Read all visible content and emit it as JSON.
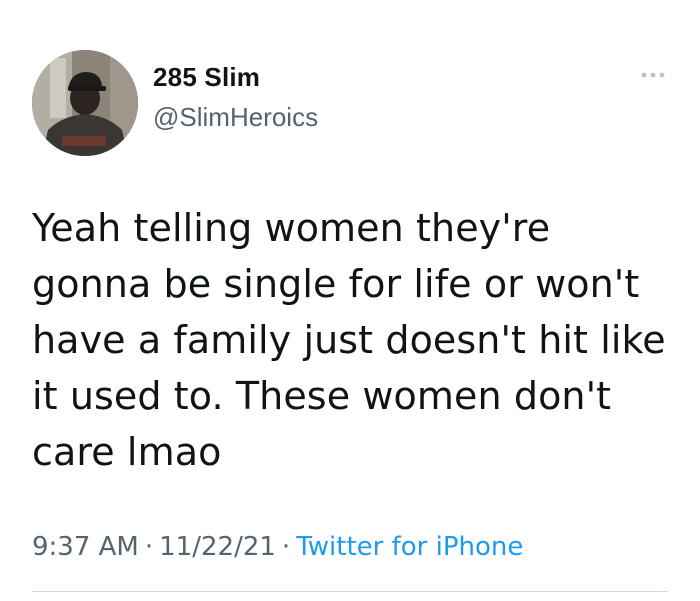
{
  "author": {
    "display_name": "285 Slim",
    "handle": "@SlimHeroics",
    "avatar_icon": "profile-photo"
  },
  "menu": {
    "icon": "more-icon"
  },
  "tweet": {
    "text": "Yeah telling women they're\ngonna be single for life or won't\nhave a family just doesn't hit like\nit used to. These women don't\ncare lmao"
  },
  "meta": {
    "time": "9:37 AM",
    "separator": "·",
    "date": "11/22/21",
    "source": "Twitter for iPhone",
    "source_color": "#1d9bf0"
  }
}
